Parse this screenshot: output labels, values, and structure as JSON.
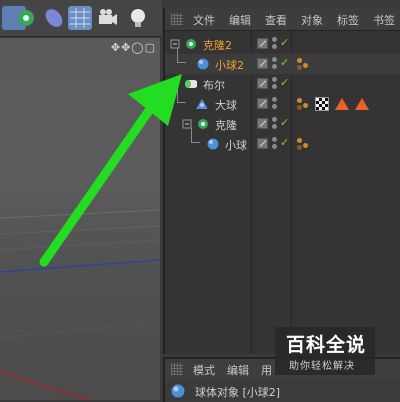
{
  "toolbar": {
    "buttons": [
      "cube-icon",
      "gear-cloner-icon",
      "deformer-icon",
      "floor-grid-icon",
      "camera-icon",
      "light-bulb-icon"
    ]
  },
  "viewport": {
    "controls": "✥✥◯▢"
  },
  "object_manager": {
    "menus": [
      "文件",
      "编辑",
      "查看",
      "对象",
      "标签",
      "书签"
    ],
    "rows": [
      {
        "label": "克隆2",
        "selected": true,
        "icon": "cloner-icon",
        "tags": []
      },
      {
        "label": "小球2",
        "selected": true,
        "icon": "sphere-icon",
        "tags": [
          "phong-tag"
        ]
      },
      {
        "label": "布尔",
        "selected": false,
        "icon": "boole-icon",
        "tags": []
      },
      {
        "label": "大球",
        "selected": false,
        "icon": "sphere-icon",
        "tags": [
          "phong-tag",
          "cloth-texture-tag",
          "material-tag",
          "material-tag"
        ]
      },
      {
        "label": "克隆",
        "selected": false,
        "icon": "cloner-icon",
        "tags": []
      },
      {
        "label": "小球",
        "selected": false,
        "icon": "sphere-icon",
        "tags": [
          "phong-tag"
        ]
      }
    ]
  },
  "attribute_manager": {
    "menus": [
      "模式",
      "编辑",
      "用"
    ],
    "object_label": "球体对象 [小球2]"
  },
  "watermark": {
    "main": "百科全说",
    "sub": "助你轻松解决"
  },
  "colors": {
    "selected_text": "#f0a23a",
    "check_green": "#6fd24a",
    "arrow_green": "#22dd22"
  }
}
